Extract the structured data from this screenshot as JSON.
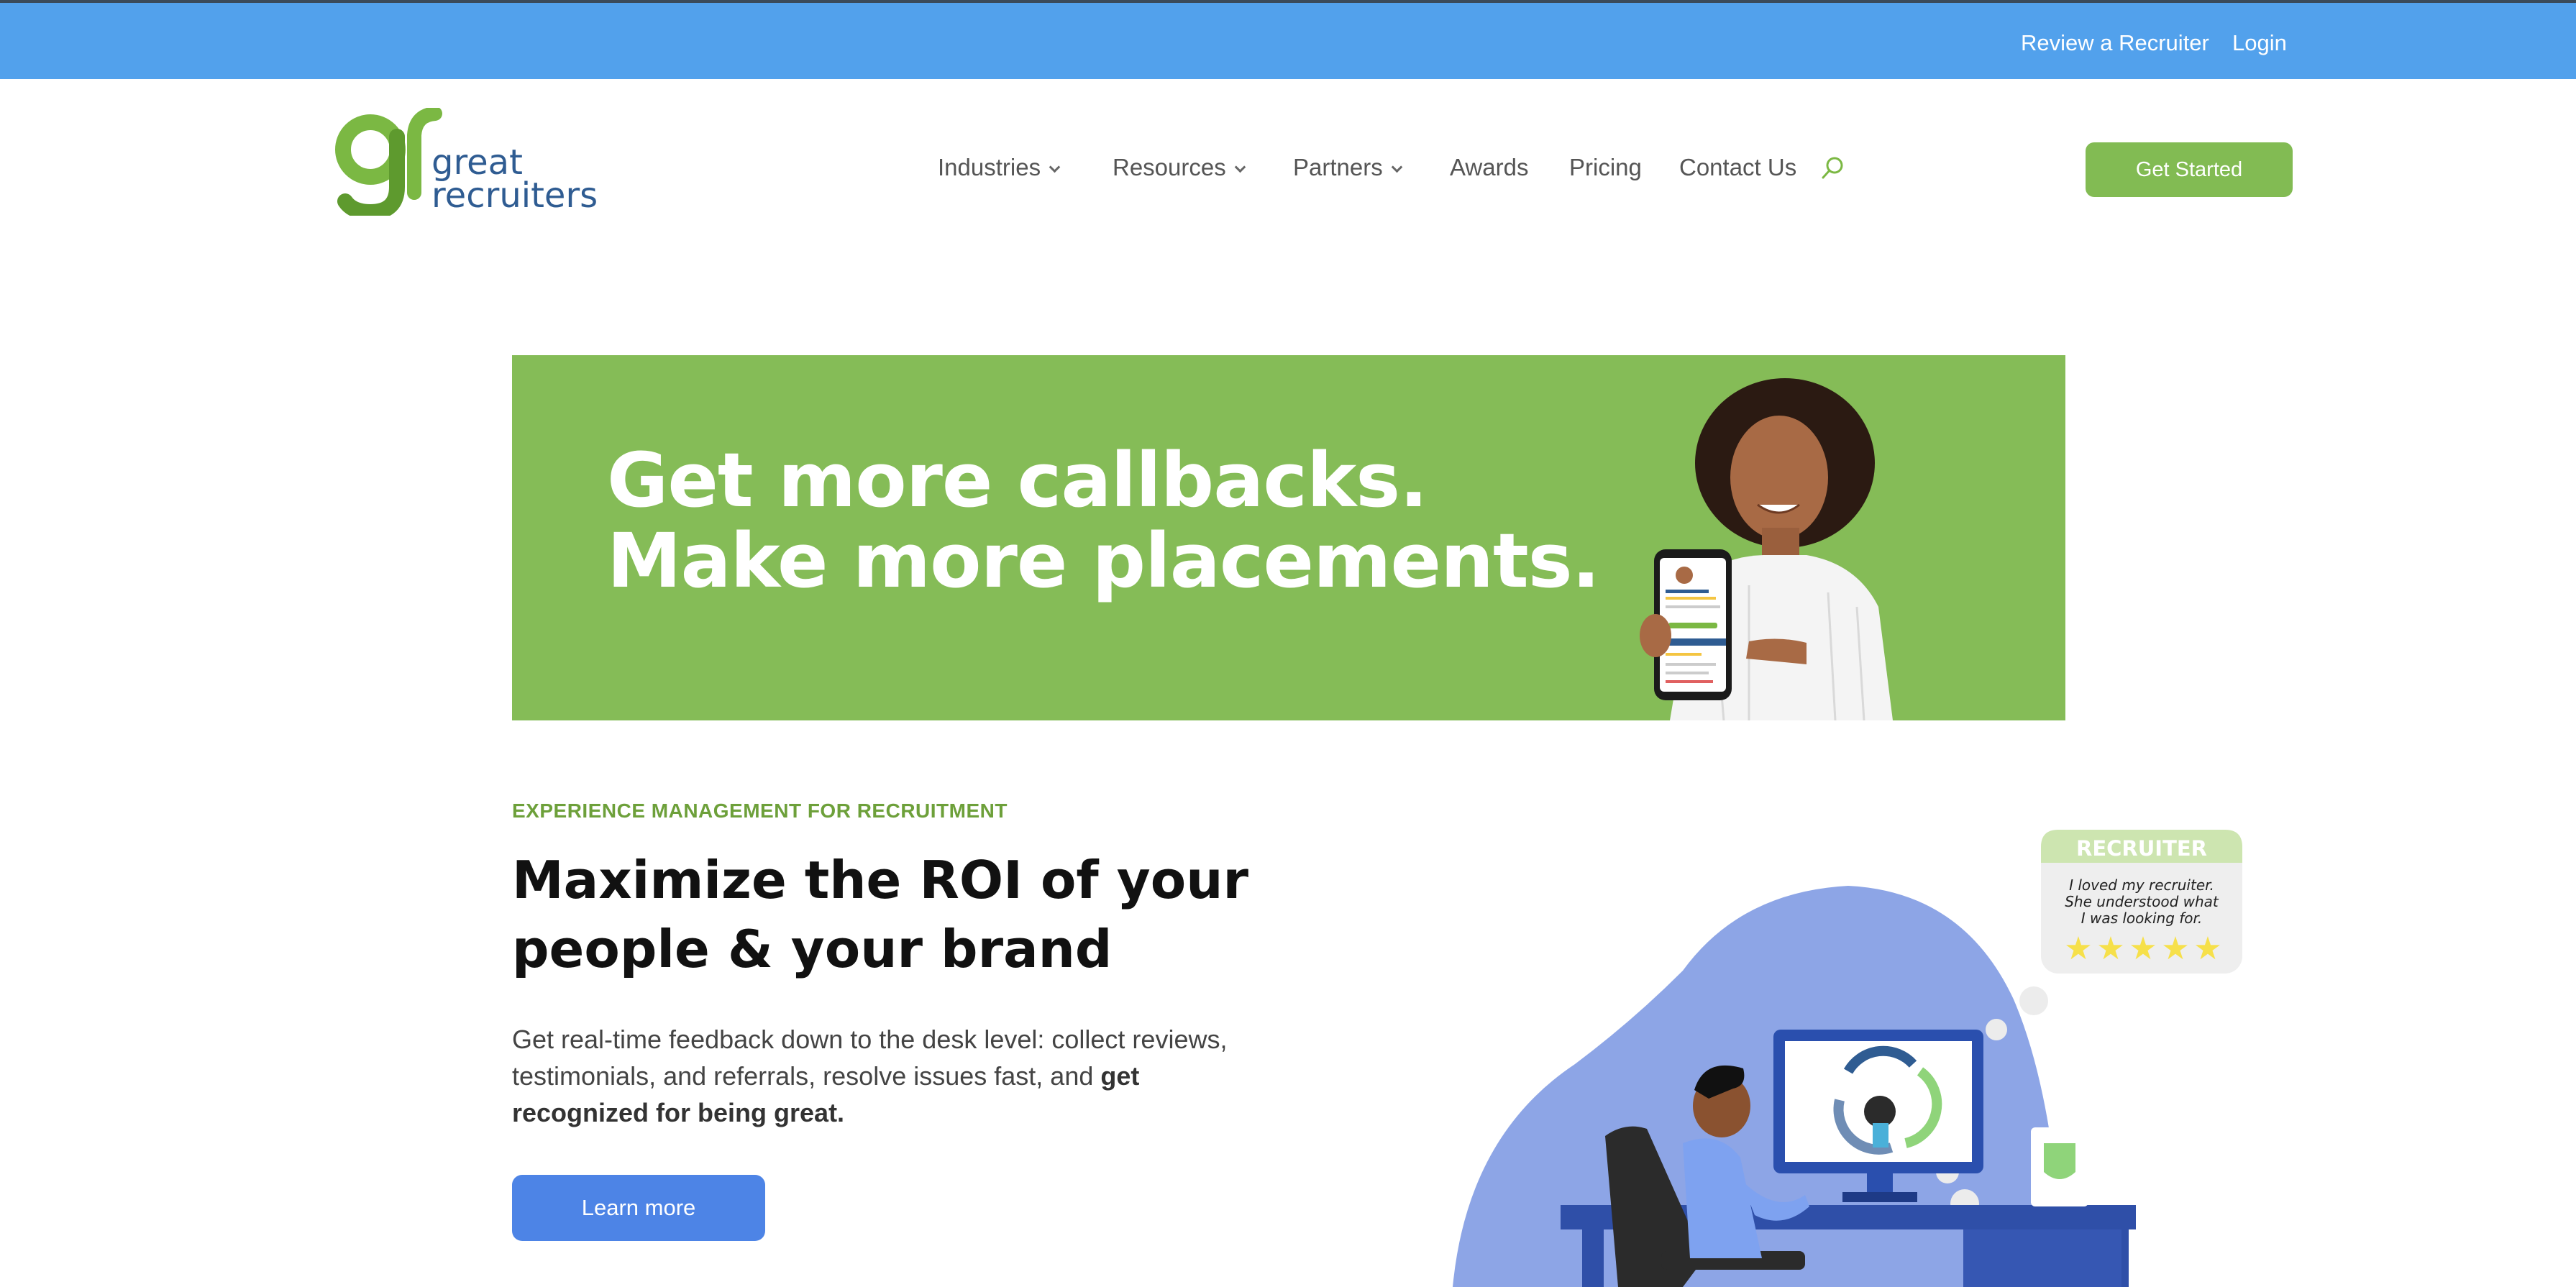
{
  "topbar": {
    "review_link": "Review a Recruiter",
    "login_link": "Login"
  },
  "logo": {
    "mark": "gr",
    "line1": "great",
    "line2": "recruiters"
  },
  "nav": {
    "items": [
      {
        "label": "Industries",
        "has_dropdown": true
      },
      {
        "label": "Resources",
        "has_dropdown": true
      },
      {
        "label": "Partners",
        "has_dropdown": true
      },
      {
        "label": "Awards",
        "has_dropdown": false
      },
      {
        "label": "Pricing",
        "has_dropdown": false
      },
      {
        "label": "Contact Us",
        "has_dropdown": false
      }
    ],
    "search_icon": "search-icon"
  },
  "cta": {
    "label": "Get Started"
  },
  "banner": {
    "line1": "Get more callbacks.",
    "line2": "Make more placements."
  },
  "section": {
    "eyebrow": "EXPERIENCE MANAGEMENT FOR RECRUITMENT",
    "heading_line1": "Maximize the ROI of your",
    "heading_line2": "people & your brand",
    "paragraph_plain": "Get real-time feedback down to the desk level: collect reviews, testimonials, and referrals, resolve issues fast, and",
    "paragraph_bold": "get recognized for being great.",
    "button": "Learn more"
  },
  "review_card": {
    "title": "RECRUITER",
    "quote_line1": "I loved my recruiter.",
    "quote_line2": "She understood what",
    "quote_line3": "I was looking for.",
    "stars": 5
  },
  "colors": {
    "topbar": "#52a1ec",
    "brand_green": "#82bb53",
    "banner_green": "#85bc57",
    "accent_blue": "#4d84e6",
    "blob": "#8da5e6"
  }
}
